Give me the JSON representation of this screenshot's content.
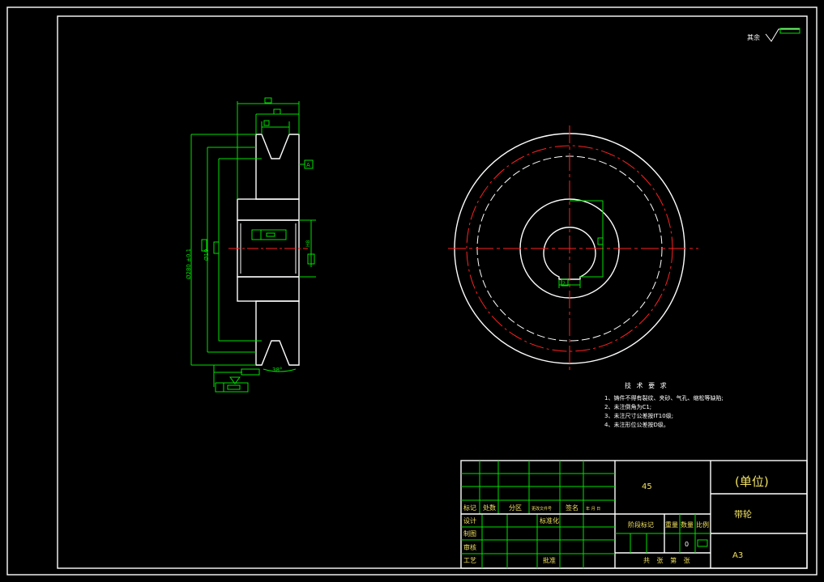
{
  "colors": {
    "background": "#000000",
    "outline": "#ffffff",
    "dimension": "#00e000",
    "centerline": "#ff2020",
    "title_text": "#f0e060"
  },
  "surface_finish": {
    "label": "其余"
  },
  "section_view": {
    "outer_diameter_dim": "Ø280 ±0.1",
    "bore_diameter_dim": "Ø10",
    "groove_angle_dim": "38°",
    "datum_label": "A",
    "dim_fit_a": "H8",
    "dim_fit_b": "D10",
    "dim_small": "2"
  },
  "end_view": {
    "key_dim": "2"
  },
  "tech_requirements": {
    "title": "技 术 要 求",
    "items": [
      "1、铸件不得有裂纹、夹砂、气孔、缩松等缺陷;",
      "2、未注倒角为C1;",
      "3、未注尺寸公差按IT10级;",
      "4、未注形位公差按D级。"
    ]
  },
  "title_block": {
    "material": "45",
    "unit": "(单位)",
    "part_name": "带轮",
    "sheet_size": "A3",
    "row_labels": [
      "标记",
      "处数",
      "分区",
      "更改文件号",
      "签名",
      "年 月 日"
    ],
    "designer": "设计",
    "standardization": "标准化",
    "drafting": "制图",
    "review": "审核",
    "process": "工艺",
    "approve": "批准",
    "stage_mark": "阶段标记",
    "weight": "重量",
    "quantity": "数量",
    "scale": "比例",
    "weight_value": "0",
    "sheet_total": "共 张 第 张"
  }
}
